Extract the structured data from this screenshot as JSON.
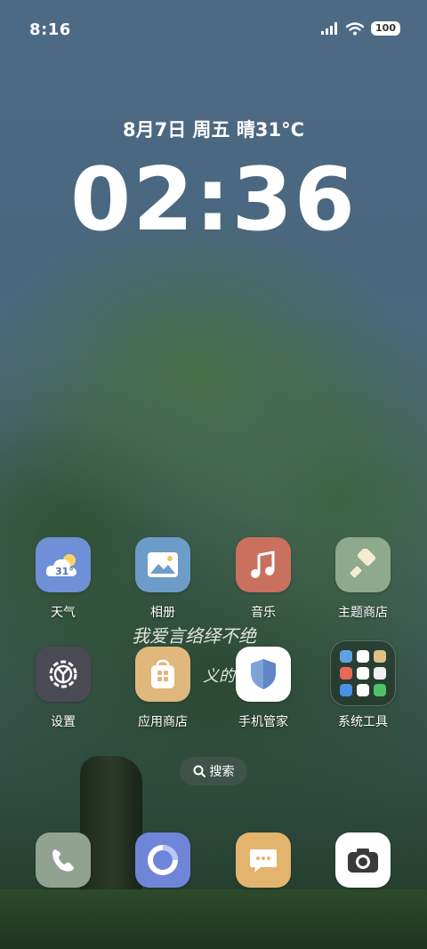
{
  "status": {
    "time": "8:16",
    "battery": "100"
  },
  "lockinfo": {
    "date_weather": "8月7日 周五 晴31°C",
    "clock": "02:36"
  },
  "apps_row1": [
    {
      "label": "天气",
      "icon": "weather-icon",
      "temp": "31°"
    },
    {
      "label": "相册",
      "icon": "gallery-icon"
    },
    {
      "label": "音乐",
      "icon": "music-icon"
    },
    {
      "label": "主题商店",
      "icon": "theme-store-icon"
    }
  ],
  "apps_row2": [
    {
      "label": "设置",
      "icon": "settings-icon"
    },
    {
      "label": "应用商店",
      "icon": "app-store-icon"
    },
    {
      "label": "手机管家",
      "icon": "phone-manager-icon"
    },
    {
      "label": "系统工具",
      "icon": "system-tools-folder-icon"
    }
  ],
  "search": {
    "label": "搜索"
  },
  "dock": [
    {
      "icon": "phone-icon"
    },
    {
      "icon": "browser-icon"
    },
    {
      "icon": "messages-icon"
    },
    {
      "icon": "camera-icon"
    }
  ],
  "handwriting": {
    "line1": "我爱言络绎不绝",
    "line2": "义的"
  },
  "colors": {
    "weather": "#6f8fd6",
    "gallery": "#6d9cc8",
    "music": "#c9705f",
    "theme": "#8fa98c",
    "settings": "#4a4a55",
    "appstore": "#e0b77c",
    "security": "#ffffff",
    "phone": "#8fa390",
    "browser": "#6f86d8",
    "messages": "#e3b46d",
    "camera": "#ffffff"
  }
}
